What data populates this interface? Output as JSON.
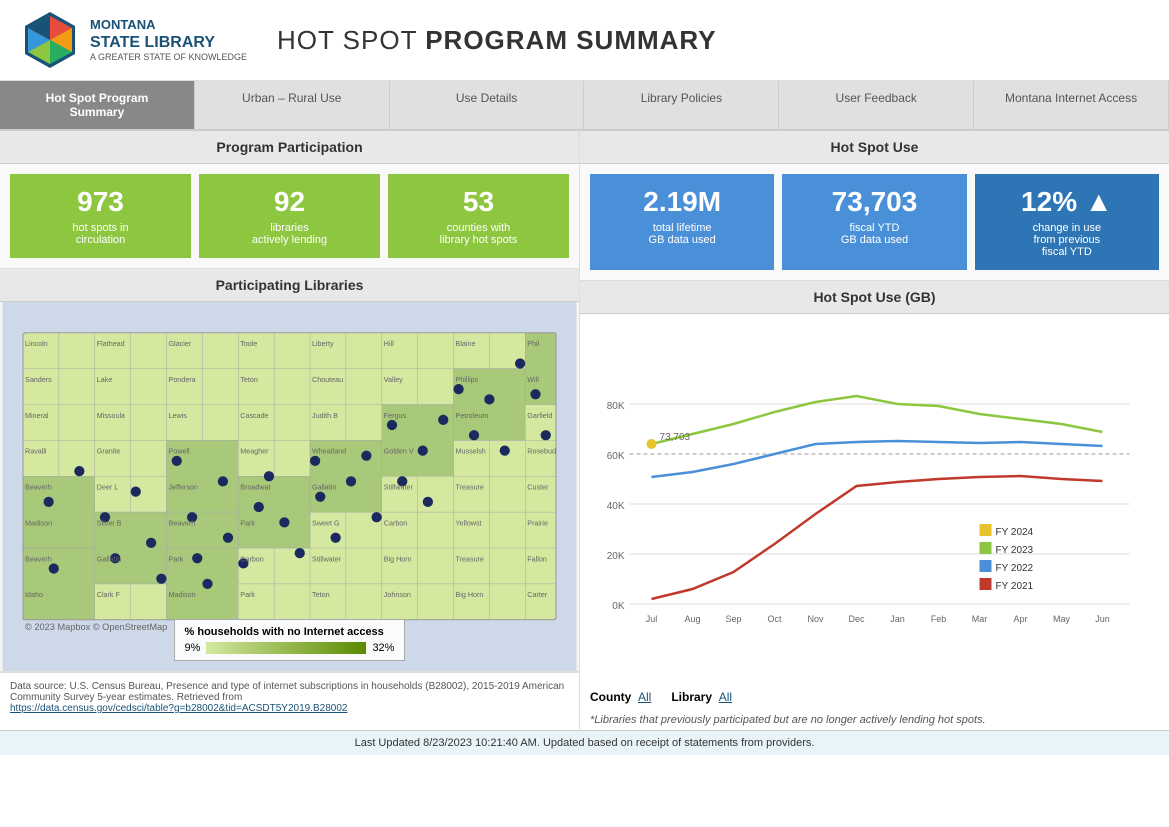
{
  "header": {
    "logo_line1": "MONTANA",
    "logo_line2": "STATE LIBRARY",
    "logo_tagline": "A GREATER STATE OF KNOWLEDGE",
    "title_prefix": "HOT SPOT ",
    "title_bold": "PROGRAM SUMMARY"
  },
  "nav": {
    "tabs": [
      {
        "label": "Hot Spot Program Summary",
        "active": true
      },
      {
        "label": "Urban – Rural Use",
        "active": false
      },
      {
        "label": "Use Details",
        "active": false
      },
      {
        "label": "Library Policies",
        "active": false
      },
      {
        "label": "User Feedback",
        "active": false
      },
      {
        "label": "Montana Internet Access",
        "active": false
      }
    ]
  },
  "program_participation": {
    "section_title": "Program Participation",
    "kpis": [
      {
        "number": "973",
        "label": "hot spots in\ncirculation"
      },
      {
        "number": "92",
        "label": "libraries\nactively lending"
      },
      {
        "number": "53",
        "label": "counties with\nlibrary hot spots"
      }
    ]
  },
  "hot_spot_use": {
    "section_title": "Hot Spot Use",
    "kpis": [
      {
        "number": "2.19M",
        "label": "total lifetime\nGB data used"
      },
      {
        "number": "73,703",
        "label": "fiscal YTD\nGB data used"
      },
      {
        "number": "12% ▲",
        "label": "change in use\nfrom previous\nfiscal YTD"
      }
    ]
  },
  "participating_libraries": {
    "section_title": "Participating Libraries"
  },
  "hot_spot_use_chart": {
    "section_title": "Hot Spot Use (GB)",
    "y_labels": [
      "0K",
      "20K",
      "40K",
      "60K",
      "80K"
    ],
    "x_labels": [
      "Jul",
      "Aug",
      "Sep",
      "Oct",
      "Nov",
      "Dec",
      "Jan",
      "Feb",
      "Mar",
      "Apr",
      "May",
      "Jun"
    ],
    "legend": [
      {
        "color": "#e8c22a",
        "label": "FY 2024"
      },
      {
        "color": "#8dc63f",
        "label": "FY 2023"
      },
      {
        "color": "#4a90d9",
        "label": "FY 2022"
      },
      {
        "color": "#c0392b",
        "label": "FY 2021"
      }
    ],
    "annotation": "73,703",
    "dotted_line_value": "60K"
  },
  "map": {
    "legend_title": "% households with no Internet access",
    "legend_min": "9%",
    "legend_max": "32%"
  },
  "data_source": {
    "text": "Data source: U.S. Census Bureau, Presence and type of internet subscriptions in households (B28002), 2015-2019 American Community Survey 5-year estimates. Retrieved from",
    "link_text": "https://data.census.gov/cedsci/table?g=b28002&tid=ACSDT5Y2019.B28002",
    "link_href": "#"
  },
  "filters": {
    "county_label": "County",
    "county_value": "All",
    "library_label": "Library",
    "library_value": "All"
  },
  "chart_note": "*Libraries that previously participated but are no longer actively lending hot spots.",
  "footer": {
    "text": "Last Updated 8/23/2023 10:21:40 AM. Updated based on receipt of statements from providers."
  }
}
